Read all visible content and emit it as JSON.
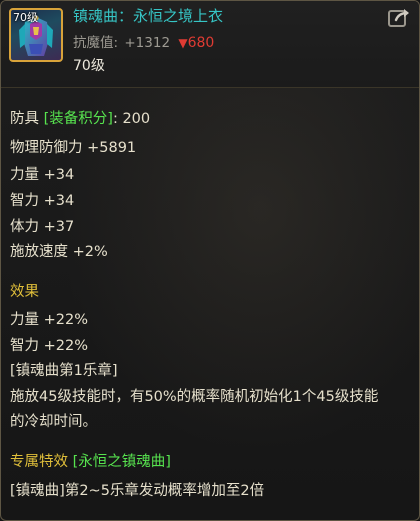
{
  "item": {
    "level_badge": "70级",
    "name": "镇魂曲：永恒之境上衣",
    "resist_label": "抗魔值:",
    "resist_plus": "+1312",
    "resist_down_arrow": "▼",
    "resist_down_value": "680",
    "level": "70级",
    "icon": "armor-item-icon"
  },
  "stats": {
    "category_label": "防具",
    "score_label": "[装备积分]",
    "score_sep": ":",
    "score_value": "200",
    "lines": [
      "物理防御力 +5891",
      "力量 +34",
      "智力 +34",
      "体力 +37",
      "施放速度 +2%"
    ]
  },
  "effect": {
    "title": "效果",
    "lines": [
      "力量 +22%",
      "智力 +22%",
      "[镇魂曲第1乐章]",
      "施放45级技能时，有50%的概率随机初始化1个45级技能",
      "的冷却时间。"
    ]
  },
  "exclusive": {
    "title": "专属特效",
    "set_name": "[永恒之镇魂曲]",
    "line": "[镇魂曲]第2~5乐章发动概率增加至2倍"
  },
  "colors": {
    "name": "#36c5c5",
    "gold": "#e0bf3a",
    "green": "#57e34f",
    "down": "#e03b33",
    "text": "#e6e0cc"
  },
  "share_icon": "share-arrow-icon"
}
